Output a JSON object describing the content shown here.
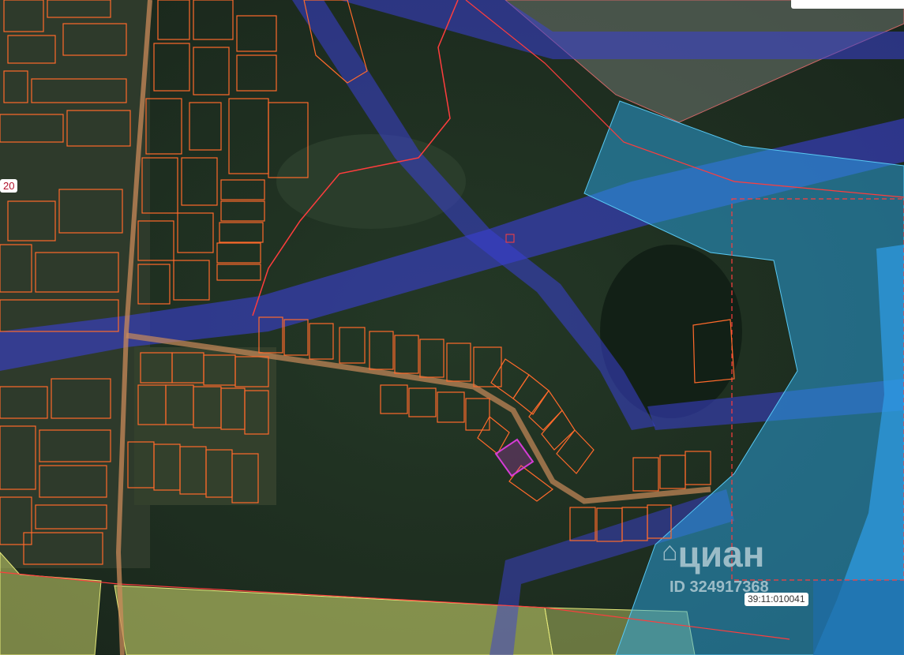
{
  "map": {
    "left_partial_label": "20",
    "cadastral_label": "39:11:010041",
    "watermark": {
      "brand": "циан",
      "id_text": "ID 324917368"
    }
  },
  "colors": {
    "parcel_outline": "#ff6a2b",
    "boundary_red": "#ff3d3d",
    "selected_parcel": "#d63cd6",
    "corridor_blue": "#3b3fd4",
    "zone_cyan": "#2aa8e8",
    "agri_yellow": "#c8d26a",
    "forest_bg": "#1f2e22"
  }
}
